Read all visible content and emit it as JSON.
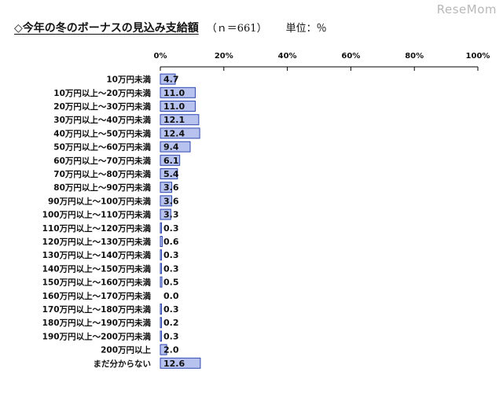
{
  "watermark": "ReseMom",
  "header": {
    "title": "◇今年の冬のボーナスの見込み支給額",
    "n": "（ｎ＝661）",
    "unit": "単位：％"
  },
  "colors": {
    "bar_fill": "#b7c3ee",
    "bar_stroke": "#2f47b0"
  },
  "chart_data": {
    "type": "bar",
    "orientation": "horizontal",
    "title": "◇今年の冬のボーナスの見込み支給額",
    "xlim": [
      0,
      100
    ],
    "x_ticks": [
      "0%",
      "20%",
      "40%",
      "60%",
      "80%",
      "100%"
    ],
    "categories": [
      "10万円未満",
      "10万円以上～20万円未満",
      "20万円以上～30万円未満",
      "30万円以上～40万円未満",
      "40万円以上～50万円未満",
      "50万円以上～60万円未満",
      "60万円以上～70万円未満",
      "70万円以上～80万円未満",
      "80万円以上～90万円未満",
      "90万円以上～100万円未満",
      "100万円以上～110万円未満",
      "110万円以上～120万円未満",
      "120万円以上～130万円未満",
      "130万円以上～140万円未満",
      "140万円以上～150万円未満",
      "150万円以上～160万円未満",
      "160万円以上～170万円未満",
      "170万円以上～180万円未満",
      "180万円以上～190万円未満",
      "190万円以上～200万円未満",
      "200万円以上",
      "まだ分からない"
    ],
    "values": [
      4.7,
      11.0,
      11.0,
      12.1,
      12.4,
      9.4,
      6.1,
      5.4,
      3.6,
      3.6,
      3.3,
      0.3,
      0.6,
      0.3,
      0.3,
      0.5,
      0.0,
      0.3,
      0.2,
      0.3,
      2.0,
      12.6
    ],
    "labels": [
      "4.7",
      "11.0",
      "11.0",
      "12.1",
      "12.4",
      "9.4",
      "6.1",
      "5.4",
      "3.6",
      "3.6",
      "3.3",
      "0.3",
      "0.6",
      "0.3",
      "0.3",
      "0.5",
      "0.0",
      "0.3",
      "0.2",
      "0.3",
      "2.0",
      "12.6"
    ]
  }
}
